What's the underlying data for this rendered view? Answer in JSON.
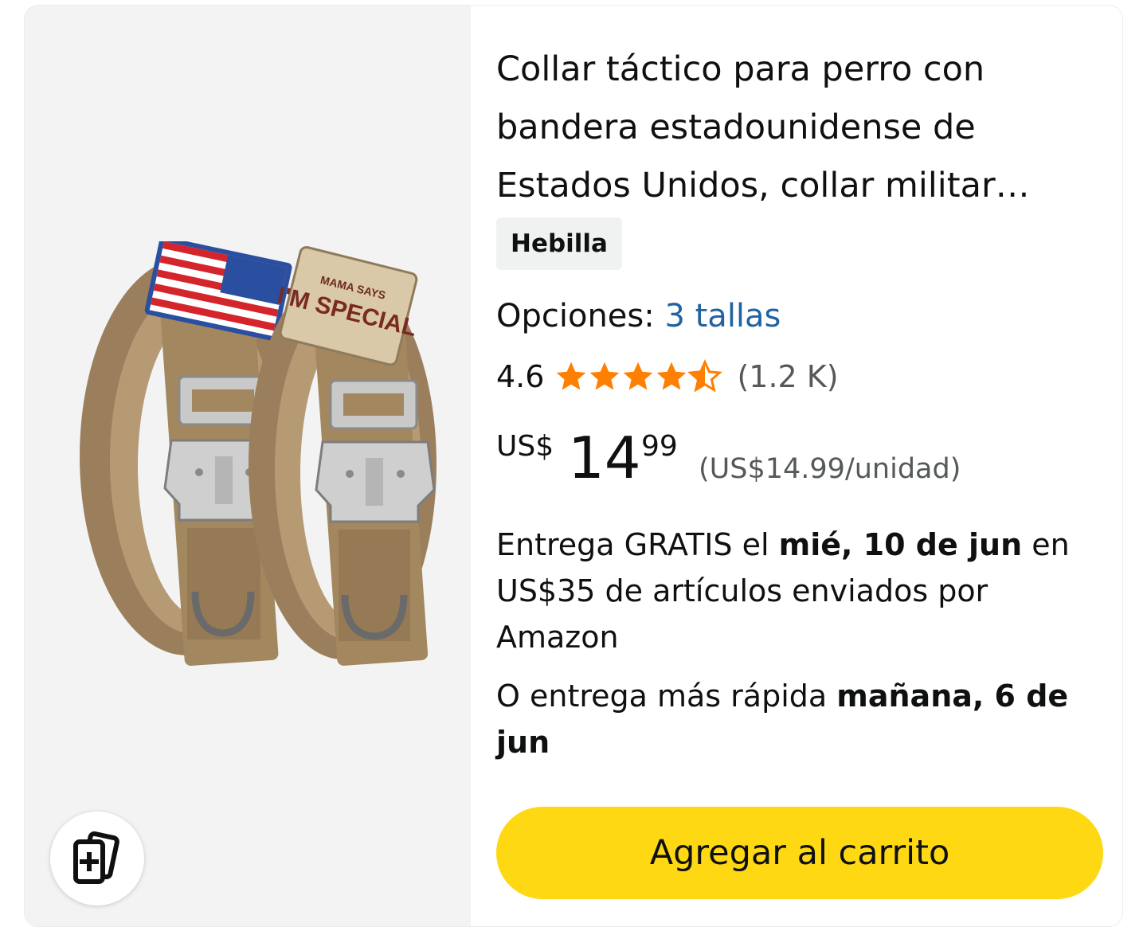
{
  "product": {
    "title": "Collar táctico para perro con bandera estadounidense de Estados Unidos, collar militar ajustable",
    "variant_chip": "Hebilla",
    "options_label": "Opciones:",
    "options_link": "3 tallas",
    "rating": "4.6",
    "rating_value": 4.6,
    "review_count": "(1.2 K)",
    "price_currency": "US$",
    "price_whole": "14",
    "price_fraction": "99",
    "unit_price": "(US$14.99/unidad)",
    "delivery": {
      "prefix": "Entrega GRATIS el ",
      "date": "mié, 10 de jun",
      "suffix": " en US$35 de artículos enviados por Amazon"
    },
    "faster": {
      "prefix": "O entrega más rápida ",
      "date": "mañana, 6 de jun"
    },
    "cart_button": "Agregar al carrito",
    "patch_text_top": "MAMA SAYS",
    "patch_text_main": "I'M SPECIAL"
  },
  "icons": {
    "compare": "add-to-compare-icon",
    "star": "star-icon"
  },
  "colors": {
    "star": "#ff7f00",
    "link": "#2162a1",
    "cart_button": "#ffd814",
    "image_bg": "#f3f3f3",
    "chip_bg": "#f0f2f2",
    "secondary_text": "#565959"
  }
}
